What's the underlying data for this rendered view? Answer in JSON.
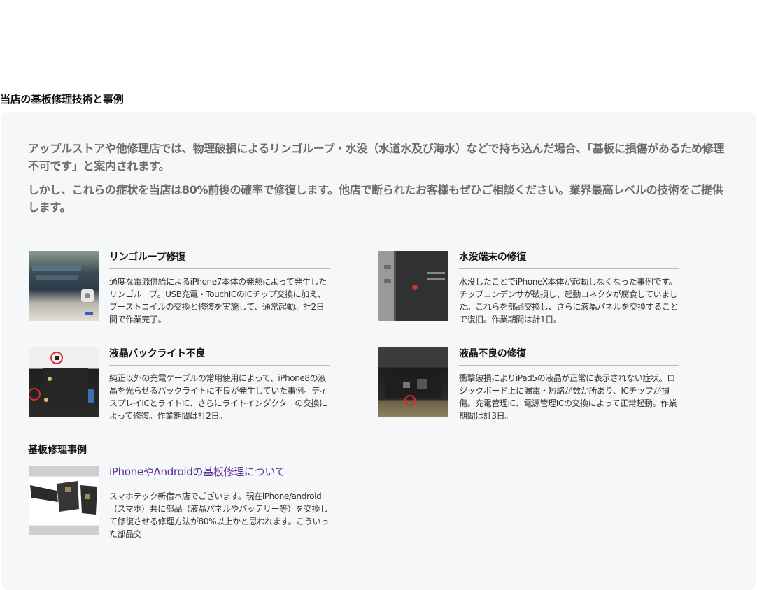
{
  "section_title": "当店の基板修理技術と事例",
  "intro": [
    "アップルストアや他修理店では、物理破損によるリンゴループ・水没（水道水及び海水）などで持ち込んだ場合、「基板に損傷があるため修理不可です」と案内されます。",
    "しかし、これらの症状を当店は80%前後の確率で修復します。他店で断られたお客様もぜひご相談ください。業界最高レベルの技術をご提供します。"
  ],
  "cases": [
    {
      "title": "リンゴループ修復",
      "description": "過度な電源供給によるiPhone7本体の発熱によって発生したリンゴループ。USB充電・TouchICのICチップ交換に加え、ブーストコイルの交換と修復を実施して、通常起動。計2日間で作業完了。"
    },
    {
      "title": "水没端末の修復",
      "description": "水没したことでiPhoneX本体が起動しなくなった事例です。チップコンデンサが破損し、起動コネクタが腐食していました。これらを部品交換し、さらに液晶パネルを交換することで復旧。作業期間は計1日。"
    },
    {
      "title": "液晶バックライト不良",
      "description": "純正以外の充電ケーブルの常用使用によって、iPhone8の液晶を光らせるバックライトに不良が発生していた事例。ディスプレイICとライトIC、さらにライトインダクターの交換によって修復。作業期間は計2日。"
    },
    {
      "title": "液晶不良の修復",
      "description": "衝撃破損によりiPad5の液晶が正常に表示されない症状。ロジックボード上に漏電・短絡が数か所あり、ICチップが損傷。充電管理IC、電源管理ICの交換によって正常起動。作業期間は計3日。"
    }
  ],
  "examples": {
    "heading": "基板修理事例",
    "item": {
      "title": "iPhoneやAndroidの基板修理について",
      "description": "スマホテック新宿本店でございます。現在iPhone/android（スマホ）共に部品（液晶パネルやバッテリー等）を交換して修復させる修理方法が80%以上かと思われます。こういった部品交"
    }
  },
  "colors": {
    "panel_bg": "#f6f7f9",
    "intro_text": "#6b6b6b",
    "link_title": "#5a3294"
  }
}
